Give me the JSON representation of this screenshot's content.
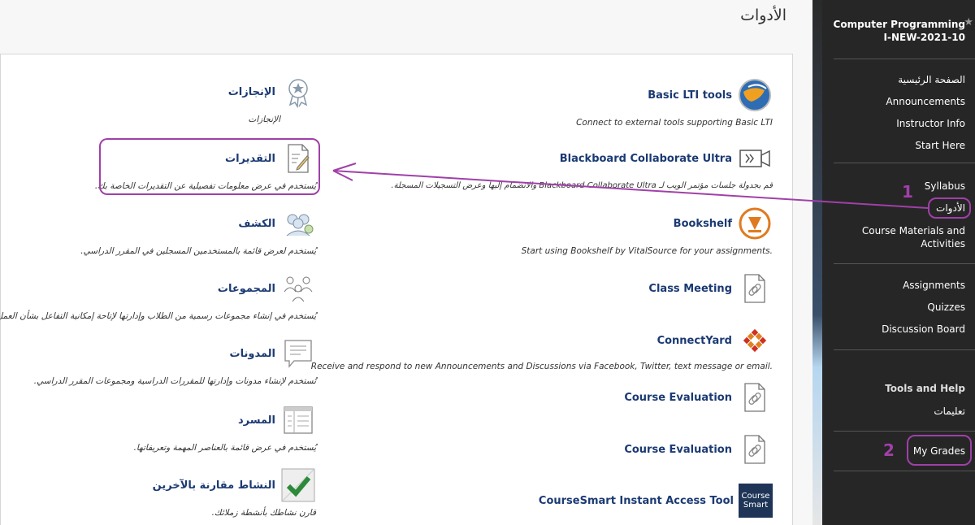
{
  "page": {
    "title": "الأدوات"
  },
  "tools_left": [
    {
      "name": "Basic LTI tools",
      "desc": "Connect to external tools supporting Basic LTI",
      "icon": "globe-icon"
    },
    {
      "name": "Blackboard Collaborate Ultra",
      "desc": "قم بجدولة جلسات مؤتمر الويب لـ Blackboard Collaborate Ultra والانضمام إليها وعرض التسجيلات المسجلة.",
      "icon": "video-camera-icon"
    },
    {
      "name": "Bookshelf",
      "desc": ".Start using Bookshelf by VitalSource for your assignments",
      "icon": "bookshelf-icon"
    },
    {
      "name": "Class Meeting",
      "desc": "",
      "icon": "link-document-icon"
    },
    {
      "name": "ConnectYard",
      "desc": ".Receive and respond to new Announcements and Discussions via Facebook, Twitter, text message or email",
      "icon": "connectyard-icon"
    },
    {
      "name": "Course Evaluation",
      "desc": "",
      "icon": "link-document-icon"
    },
    {
      "name": "Course Evaluation",
      "desc": "",
      "icon": "link-document-icon"
    },
    {
      "name": "CourseSmart Instant Access Tool",
      "desc": "",
      "icon": "coursesmart-icon",
      "icon_text": "Course Smart"
    }
  ],
  "tools_right": [
    {
      "name": "الإنجازات",
      "desc": "الإنجازات",
      "icon": "achievement-badge-icon"
    },
    {
      "name": "التقديرات",
      "desc": "يُستخدم في عرض معلومات تفصيلية عن التقديرات الخاصة بك.",
      "icon": "grades-document-icon"
    },
    {
      "name": "الكشف",
      "desc": "يُستخدم لعرض قائمة بالمستخدمين المسجلين في المقرر الدراسي.",
      "icon": "roster-icon"
    },
    {
      "name": "المجموعات",
      "desc": "يُستخدم في إنشاء مجموعات رسمية من الطلاب وإدارتها لإتاحة إمكانية التفاعل بشأن العمل.",
      "icon": "groups-icon"
    },
    {
      "name": "المدونات",
      "desc": "تُستخدم لإنشاء مدونات وإدارتها للمقررات الدراسية ومجموعات المقرر الدراسي.",
      "icon": "blog-icon"
    },
    {
      "name": "المسرد",
      "desc": "يُستخدم في عرض قائمة بالعناصر المهمة وتعريفاتها.",
      "icon": "glossary-icon"
    },
    {
      "name": "النشاط مقارنة بالآخرين",
      "desc": "قارن نشاطك بأنشطة زملائك.",
      "icon": "activity-check-icon"
    }
  ],
  "sidebar": {
    "course_title": "Computer Programming I-NEW-2021-10",
    "items_a": [
      "الصفحة الرئيسية",
      "Announcements",
      "Instructor Info",
      "Start Here"
    ],
    "items_b": [
      "Syllabus",
      "الأدوات",
      "Course Materials and Activities"
    ],
    "items_c": [
      "Assignments",
      "Quizzes",
      "Discussion Board"
    ],
    "heading": "Tools and Help",
    "items_d": [
      "تعليمات"
    ],
    "items_e": [
      "My Grades"
    ]
  },
  "annotations": {
    "num1": "1",
    "num2": "2",
    "color": "#a040a8"
  }
}
